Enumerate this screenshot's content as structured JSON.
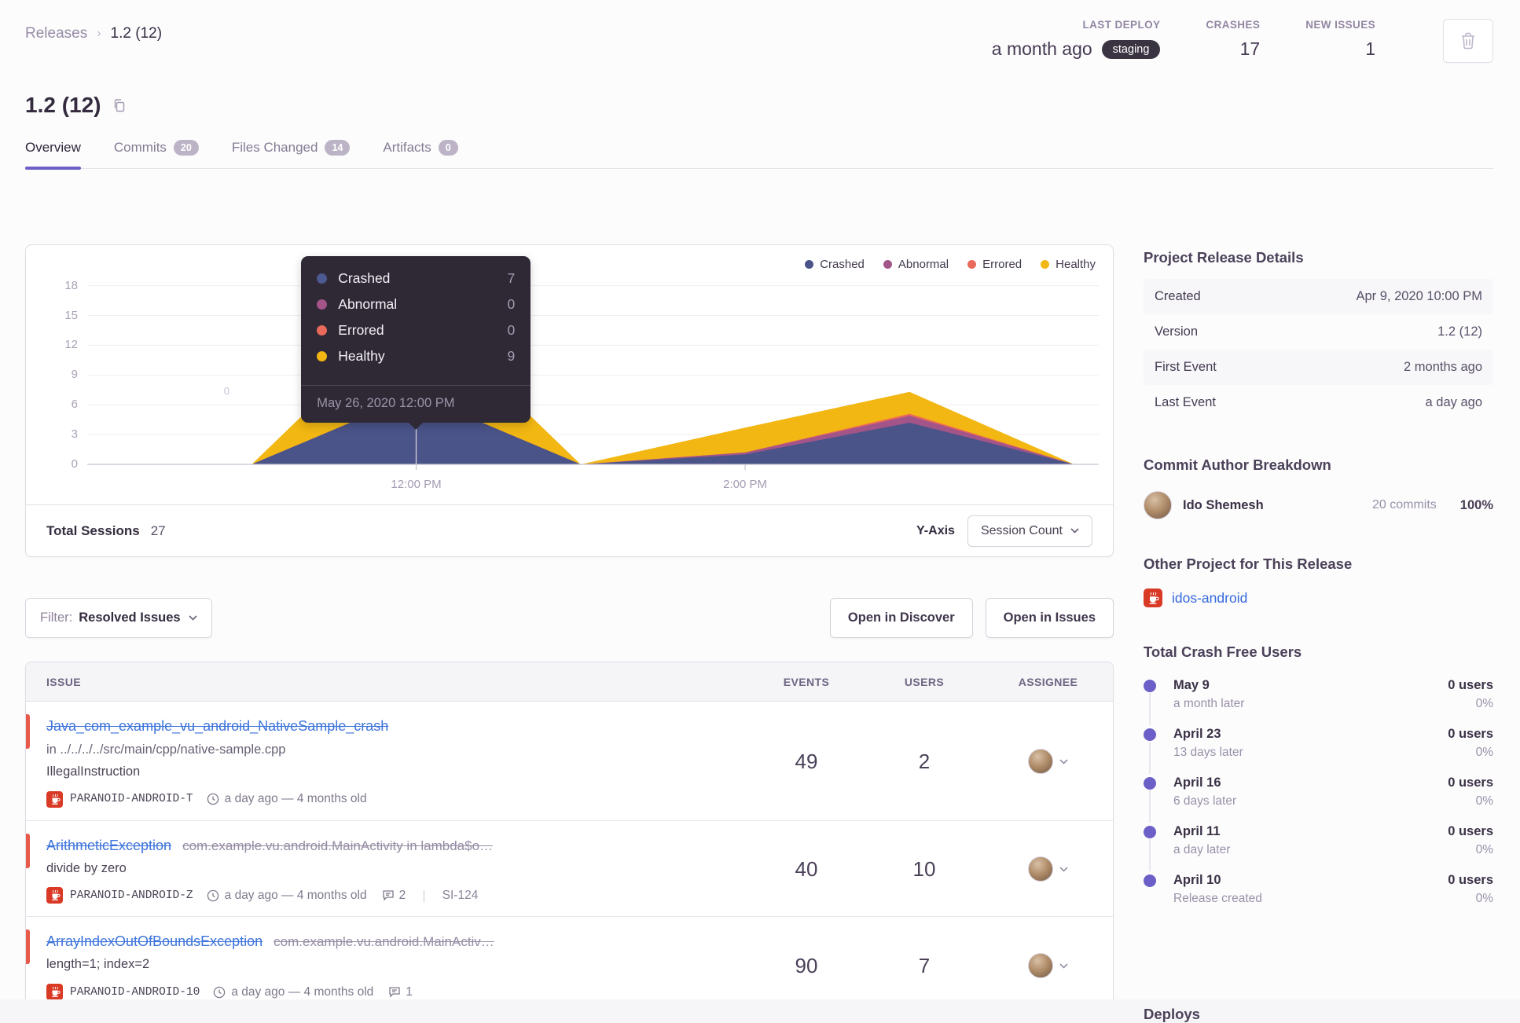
{
  "breadcrumb": {
    "parent": "Releases",
    "current": "1.2 (12)"
  },
  "header_stats": {
    "last_deploy": {
      "label": "LAST DEPLOY",
      "value": "a month ago",
      "badge": "staging"
    },
    "crashes": {
      "label": "CRASHES",
      "value": "17"
    },
    "new_issues": {
      "label": "NEW ISSUES",
      "value": "1"
    }
  },
  "page_title": "1.2 (12)",
  "tabs": [
    {
      "label": "Overview",
      "badge": null,
      "active": true
    },
    {
      "label": "Commits",
      "badge": "20",
      "active": false
    },
    {
      "label": "Files Changed",
      "badge": "14",
      "active": false
    },
    {
      "label": "Artifacts",
      "badge": "0",
      "active": false
    }
  ],
  "chart_data": {
    "type": "area",
    "stacked": true,
    "title": "Release sessions over time",
    "x_hours": [
      10,
      11,
      12,
      13,
      14,
      15,
      16
    ],
    "x_domain": [
      10,
      16.15
    ],
    "ylim": [
      0,
      19
    ],
    "y_ticks": [
      0,
      3,
      6,
      9,
      12,
      15,
      18
    ],
    "x_tick_labels": [
      {
        "hour": 12,
        "label": "12:00 PM"
      },
      {
        "hour": 14,
        "label": "2:00 PM"
      }
    ],
    "grid": true,
    "legend_position": "top-right",
    "series": [
      {
        "name": "Crashed",
        "color": "#4A5489",
        "values": [
          0,
          0,
          7,
          0,
          1.0,
          4.2,
          0
        ]
      },
      {
        "name": "Abnormal",
        "color": "#A35488",
        "values": [
          0,
          0,
          0,
          0,
          0.2,
          0.7,
          0
        ]
      },
      {
        "name": "Errored",
        "color": "#E9695B",
        "values": [
          0,
          0,
          0,
          0,
          0.0,
          0.2,
          0
        ]
      },
      {
        "name": "Healthy",
        "color": "#F2B712",
        "values": [
          0,
          0,
          9,
          0,
          2.5,
          2.2,
          0
        ]
      }
    ],
    "stray_point_label": "0",
    "tooltip": {
      "hover_hour": 12,
      "rows": [
        {
          "label": "Crashed",
          "value": "7",
          "color": "#4D5991"
        },
        {
          "label": "Abnormal",
          "value": "0",
          "color": "#A35488"
        },
        {
          "label": "Errored",
          "value": "0",
          "color": "#E9695B"
        },
        {
          "label": "Healthy",
          "value": "9",
          "color": "#F2B712"
        }
      ],
      "footer": "May 26, 2020 12:00 PM"
    }
  },
  "chart_footer": {
    "total_sessions_label": "Total Sessions",
    "total_sessions_value": "27",
    "y_axis_label": "Y-Axis",
    "y_axis_value": "Session Count"
  },
  "filter_bar": {
    "filter_label": "Filter:",
    "filter_value": "Resolved Issues",
    "open_discover": "Open in Discover",
    "open_issues": "Open in Issues"
  },
  "issues_table": {
    "columns": [
      "ISSUE",
      "EVENTS",
      "USERS",
      "ASSIGNEE"
    ],
    "rows": [
      {
        "title": "Java_com_example_vu_android_NativeSample_crash",
        "culprit": "",
        "subtitle": "in ../../../../src/main/cpp/native-sample.cpp",
        "extra": "IllegalInstruction",
        "project": "PARANOID-ANDROID-T",
        "age": "a day ago — 4 months old",
        "comments": "",
        "short_id": "",
        "events": "49",
        "users": "2"
      },
      {
        "title": "ArithmeticException",
        "culprit": "com.example.vu.android.MainActivity in lambda$o…",
        "subtitle": "divide by zero",
        "extra": "",
        "project": "PARANOID-ANDROID-Z",
        "age": "a day ago — 4 months old",
        "comments": "2",
        "short_id": "SI-124",
        "events": "40",
        "users": "10"
      },
      {
        "title": "ArrayIndexOutOfBoundsException",
        "culprit": "com.example.vu.android.MainActiv…",
        "subtitle": "length=1; index=2",
        "extra": "",
        "project": "PARANOID-ANDROID-10",
        "age": "a day ago — 4 months old",
        "comments": "1",
        "short_id": "",
        "events": "90",
        "users": "7"
      }
    ]
  },
  "sidebar": {
    "release_details": {
      "title": "Project Release Details",
      "rows": [
        [
          "Created",
          "Apr 9, 2020 10:00 PM"
        ],
        [
          "Version",
          "1.2 (12)"
        ],
        [
          "First Event",
          "2 months ago"
        ],
        [
          "Last Event",
          "a day ago"
        ]
      ]
    },
    "commit_authors": {
      "title": "Commit Author Breakdown",
      "author": {
        "name": "Ido Shemesh",
        "commits": "20 commits",
        "percent": "100%"
      }
    },
    "other_project": {
      "title": "Other Project for This Release",
      "project": "idos-android"
    },
    "crash_free": {
      "title": "Total Crash Free Users",
      "entries": [
        {
          "date": "May 9",
          "sub": "a month later",
          "users": "0 users",
          "pct": "0%"
        },
        {
          "date": "April 23",
          "sub": "13 days later",
          "users": "0 users",
          "pct": "0%"
        },
        {
          "date": "April 16",
          "sub": "6 days later",
          "users": "0 users",
          "pct": "0%"
        },
        {
          "date": "April 11",
          "sub": "a day later",
          "users": "0 users",
          "pct": "0%"
        },
        {
          "date": "April 10",
          "sub": "Release created",
          "users": "0 users",
          "pct": "0%"
        }
      ]
    },
    "deploys_title": "Deploys"
  },
  "icons": {
    "delete": "trash-icon",
    "copy": "copy-icon",
    "clock": "clock-icon",
    "comments": "comment-icon",
    "dropdown": "chevron-down-icon",
    "project_platform": "java-coffee-icon"
  },
  "colors": {
    "accent_purple": "#6C5FC7",
    "link_blue": "#3D74DB",
    "danger_red": "#E8594A",
    "staging_badge_bg": "#3A3442",
    "tooltip_bg": "#2F2936"
  }
}
